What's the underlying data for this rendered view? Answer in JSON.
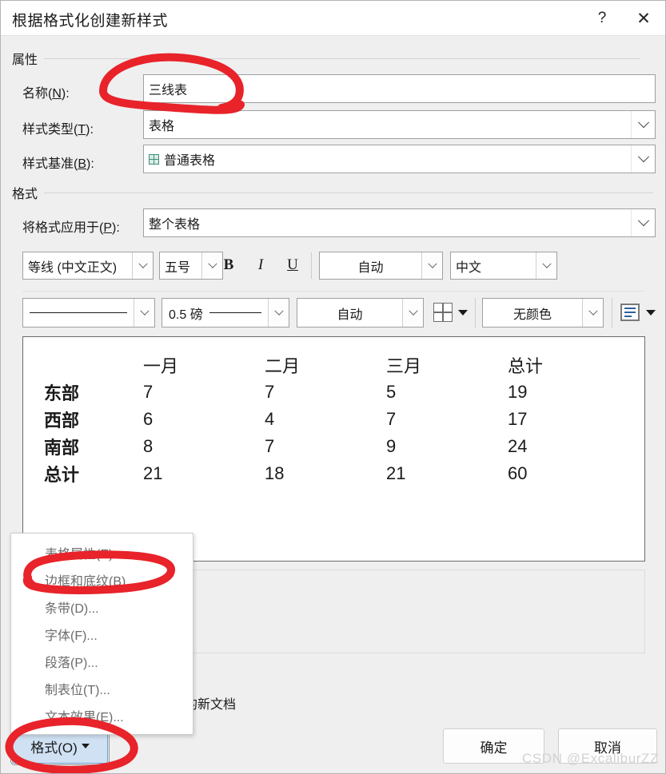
{
  "window": {
    "title": "根据格式化创建新样式",
    "help_label": "?",
    "close_label": "✕"
  },
  "sections": {
    "properties_label": "属性",
    "format_label": "格式"
  },
  "fields": {
    "name": {
      "label_prefix": "名称(",
      "label_key": "N",
      "label_suffix": "):",
      "value": "三线表"
    },
    "style_type": {
      "label_prefix": "样式类型(",
      "label_key": "T",
      "label_suffix": "):",
      "value": "表格"
    },
    "style_basis": {
      "label_prefix": "样式基准(",
      "label_key": "B",
      "label_suffix": "):",
      "value": "普通表格",
      "icon": "table-grid-icon"
    },
    "apply_to": {
      "label_prefix": "将格式应用于(",
      "label_key": "P",
      "label_suffix": "):",
      "value": "整个表格"
    }
  },
  "toolbar_row1": {
    "font_family": "等线 (中文正文)",
    "font_size": "五号",
    "bold_label": "B",
    "italic_label": "I",
    "underline_label": "U",
    "font_color": "自动",
    "language": "中文"
  },
  "toolbar_row2": {
    "line_style": "",
    "line_style_icon": "solid-line-icon",
    "line_weight": "0.5 磅",
    "line_color": "自动",
    "borders_icon": "border-grid-icon",
    "shading_color": "无颜色",
    "shading_icon": "text-lines-icon"
  },
  "preview": {
    "columns": [
      "",
      "一月",
      "二月",
      "三月",
      "总计"
    ],
    "rows": [
      {
        "header": "东部",
        "cells": [
          "7",
          "7",
          "5",
          "19"
        ]
      },
      {
        "header": "西部",
        "cells": [
          "6",
          "4",
          "7",
          "17"
        ]
      },
      {
        "header": "南部",
        "cells": [
          "8",
          "7",
          "9",
          "24"
        ]
      },
      {
        "header": "总计",
        "cells": [
          "21",
          "18",
          "21",
          "60"
        ]
      }
    ]
  },
  "options": {
    "new_docs_from_template": "该模板的新文档"
  },
  "context_menu": {
    "items": [
      "表格属性(E)...",
      "边框和底纹(B)...",
      "条带(D)...",
      "字体(F)...",
      "段落(P)...",
      "制表位(T)...",
      "文本效果(E)..."
    ]
  },
  "buttons": {
    "format": "格式(O)",
    "ok": "确定",
    "cancel": "取消"
  },
  "watermark": "CSDN @ExcaliburZZ",
  "colors": {
    "annotation_red": "#e8232a",
    "dialog_bg": "#efefef",
    "pressed_button_bg": "#cfe1f3"
  }
}
